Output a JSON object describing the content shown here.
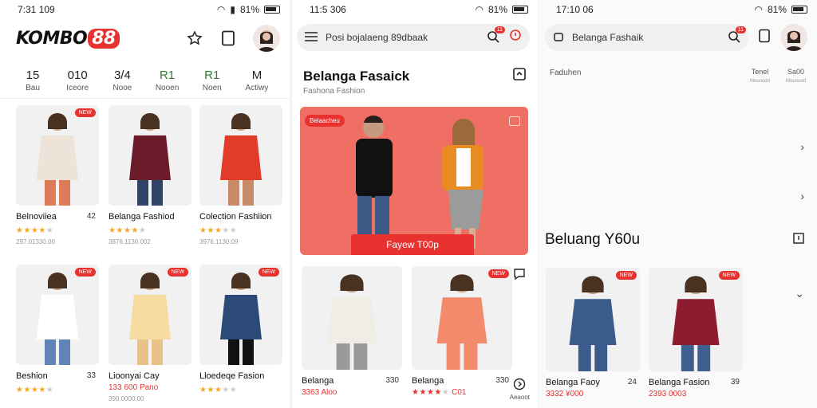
{
  "screen1": {
    "status": {
      "time": "7:31 109",
      "battery": "81%"
    },
    "logo": {
      "text": "KOMBO",
      "num": "88"
    },
    "categories": [
      {
        "value": "15",
        "label": "Bau",
        "active": true
      },
      {
        "value": "010",
        "label": "Iceore"
      },
      {
        "value": "3/4",
        "label": "Nooe"
      },
      {
        "value": "R1",
        "label": "Nooen"
      },
      {
        "value": "R1",
        "label": "Noen"
      },
      {
        "value": "M",
        "label": "Actiwy"
      }
    ],
    "products": [
      {
        "name": "Belnoviiea",
        "count": "42",
        "badge": "NEW",
        "rating": 4,
        "meta": "297.01330.00"
      },
      {
        "name": "Belanga Fashiod",
        "count": "",
        "badge": "",
        "rating": 4,
        "meta": "3876.1130.002"
      },
      {
        "name": "Colection Fashiion",
        "count": "",
        "badge": "",
        "rating": 3,
        "meta": "3976.1130.09"
      },
      {
        "name": "Beshion",
        "count": "33",
        "badge": "NEW",
        "rating": 4,
        "meta": ""
      },
      {
        "name": "Lioonyai Cay",
        "count": "",
        "badge": "NEW",
        "rating": 0,
        "price": "133 600",
        "price_note": "Pano",
        "meta": "390.0000.00"
      },
      {
        "name": "Lloedeqe Fasion",
        "count": "",
        "badge": "NEW",
        "rating": 3,
        "meta": ""
      }
    ]
  },
  "screen2": {
    "status": {
      "time": "11:5 306",
      "battery": "81%"
    },
    "search_placeholder": "Posi bojalaeng 89dbaak",
    "notif_count": "11",
    "title": "Belanga Fasaick",
    "subtitle": "Fashona Fashion",
    "hero": {
      "tag": "Belaacheu",
      "cta": "Fayew T00p"
    },
    "products": [
      {
        "name": "Belanga",
        "count": "330",
        "price": "3363 Aloo"
      },
      {
        "name": "Belanga",
        "count": "330",
        "price": "C01",
        "badge": "NEW",
        "rating": 4
      }
    ],
    "side_label": "Aeaoot"
  },
  "screen3": {
    "status": {
      "time": "17:10 06",
      "battery": "81%"
    },
    "search_placeholder": "Belanga Fashaik",
    "notif_count": "11",
    "tab_left": "Faduhen",
    "tab_right": [
      {
        "a": "Tenel",
        "b": "Mounodd"
      },
      {
        "a": "Sa00",
        "b": "Mounodd"
      }
    ],
    "title": "Beluang Y60u",
    "products": [
      {
        "name": "Belanga Faoy",
        "count": "24",
        "price": "3332 ¥000",
        "badge": "NEW"
      },
      {
        "name": "Belanga Fasion",
        "count": "39",
        "price": "2393 0003",
        "badge": "NEW"
      }
    ]
  },
  "colors": {
    "accent": "#e8322f",
    "hero_bg": "#ef6f64",
    "star": "#f5a623"
  }
}
